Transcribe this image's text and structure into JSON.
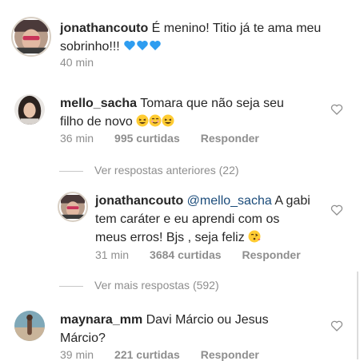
{
  "comments": [
    {
      "username": "jonathancouto",
      "text": " É menino! Titio já te ama meu",
      "text2": "sobrinho!!!",
      "time": "40 min"
    },
    {
      "username": "mello_sacha",
      "text": " Tomara que não seja seu",
      "text2": "filho de novo",
      "time": "36 min",
      "likes": "995 curtidas",
      "reply": "Responder"
    },
    {
      "username": "jonathancouto",
      "mention": "@mello_sacha",
      "text": " A gabi",
      "text2": "tem caráter e eu aprendi com os",
      "text3": "meus erros! Bjs , seja feliz",
      "time": "31 min",
      "likes": "3684 curtidas",
      "reply": "Responder"
    },
    {
      "username": "maynara_mm",
      "text": " Davi Márcio ou Jesus",
      "text2": "Márcio?",
      "time": "39 min",
      "likes": "221 curtidas",
      "reply": "Responder"
    }
  ],
  "view_previous": "Ver respostas anteriores (22)",
  "view_more": "Ver mais respostas (592)",
  "icons": {
    "heart": "heart-outline-icon",
    "emoji_blue_hearts": "blue-heart-emoji",
    "emoji_laughing": "grinning-squinting-emoji",
    "emoji_kiss": "face-blowing-kiss-emoji"
  },
  "colors": {
    "blue_heart": "#2e9df0",
    "emoji_yellow": "#ffcc33",
    "meta_gray": "#8e8e8e"
  }
}
